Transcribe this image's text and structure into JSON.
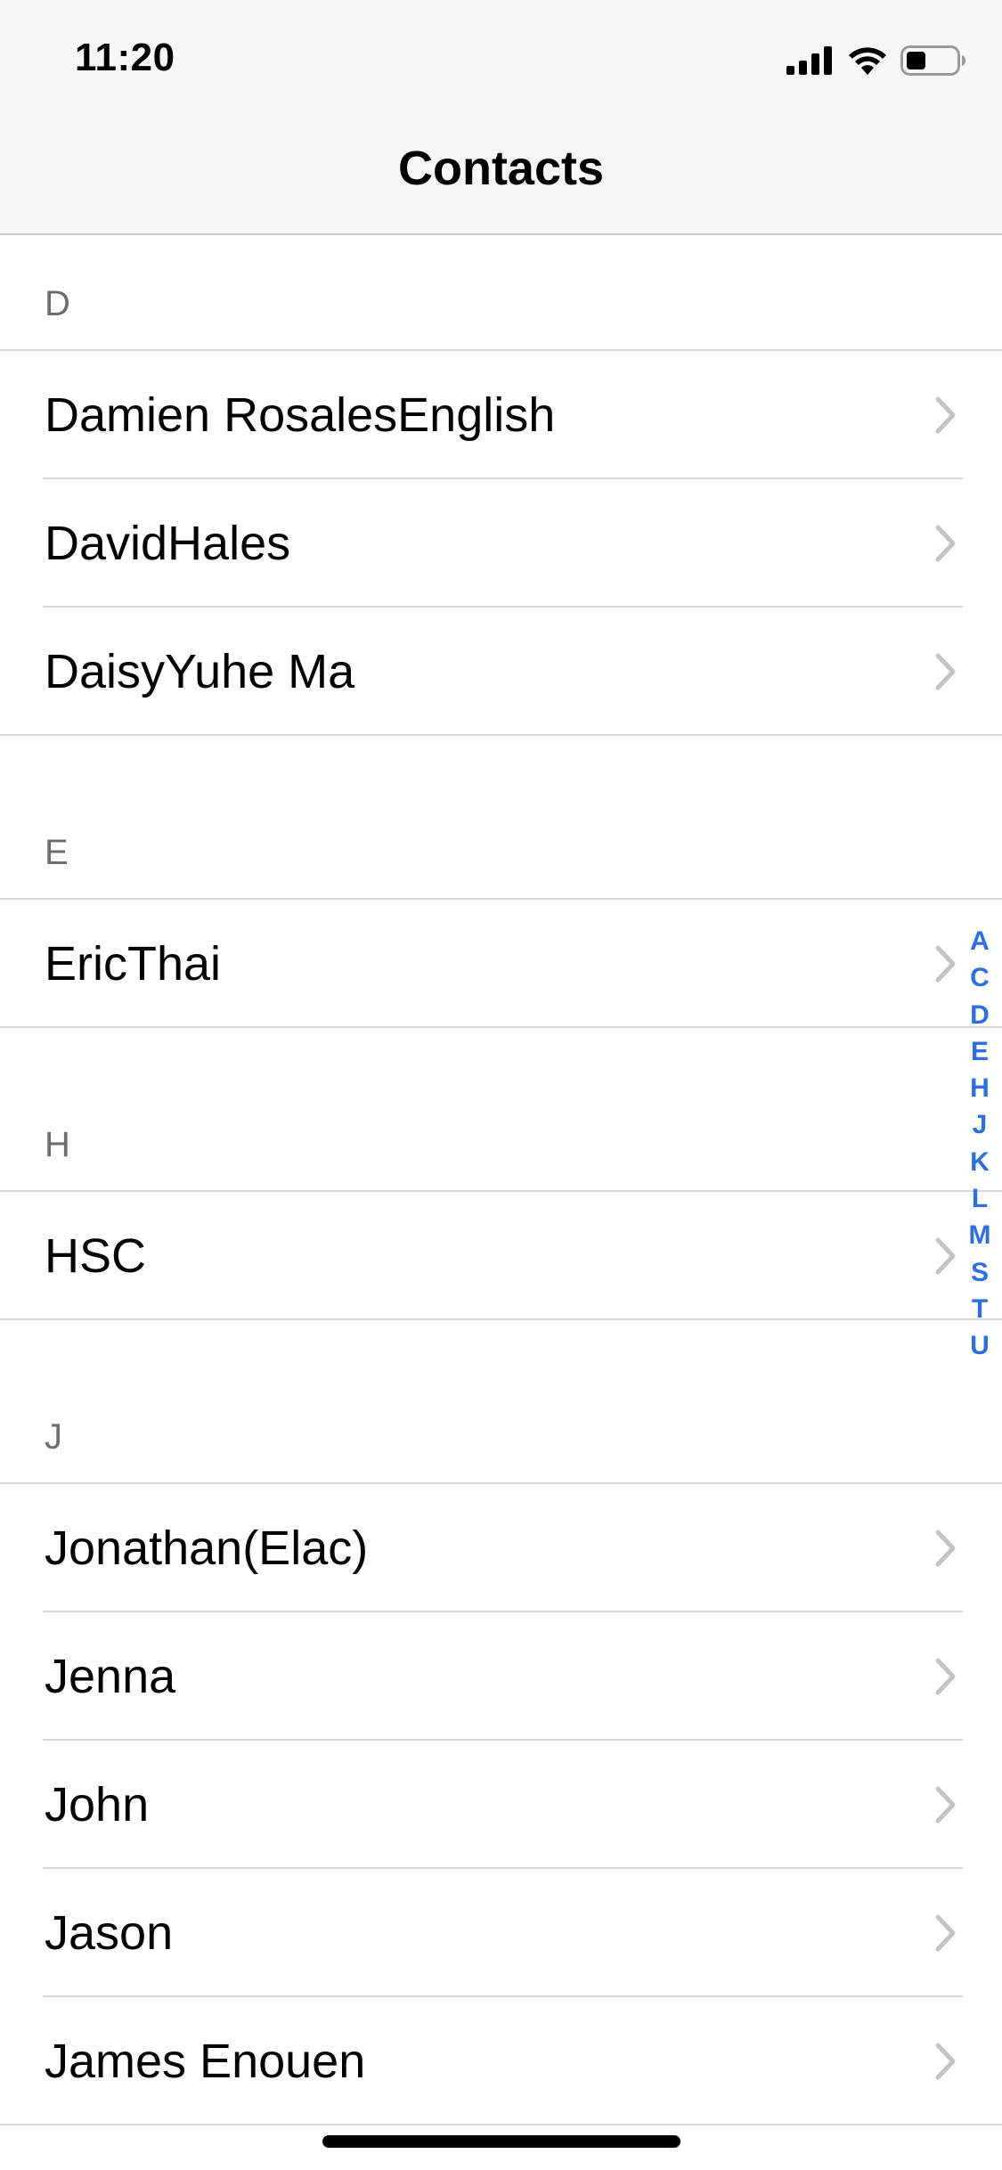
{
  "status_bar": {
    "time": "11:20",
    "battery_level": 0.4
  },
  "header": {
    "title": "Contacts"
  },
  "sections": [
    {
      "letter": "D",
      "contacts": [
        "Damien RosalesEnglish",
        "DavidHales",
        "DaisyYuhe Ma"
      ]
    },
    {
      "letter": "E",
      "contacts": [
        "EricThai"
      ]
    },
    {
      "letter": "H",
      "contacts": [
        "HSC"
      ]
    },
    {
      "letter": "J",
      "contacts": [
        "Jonathan(Elac)",
        "Jenna",
        "John",
        "Jason",
        "James Enouen"
      ]
    }
  ],
  "index_letters": [
    "A",
    "C",
    "D",
    "E",
    "H",
    "J",
    "K",
    "L",
    "M",
    "S",
    "T",
    "U"
  ],
  "icons": {
    "row_accessory": "chevron-right-icon",
    "signal": "cellular-signal-icon",
    "wifi": "wifi-icon",
    "battery": "battery-icon"
  },
  "colors": {
    "index_accent": "#2d6fe0",
    "header_bg": "#f7f7f7",
    "section_letter": "#6d6d72",
    "chevron": "#c4c4c7"
  }
}
